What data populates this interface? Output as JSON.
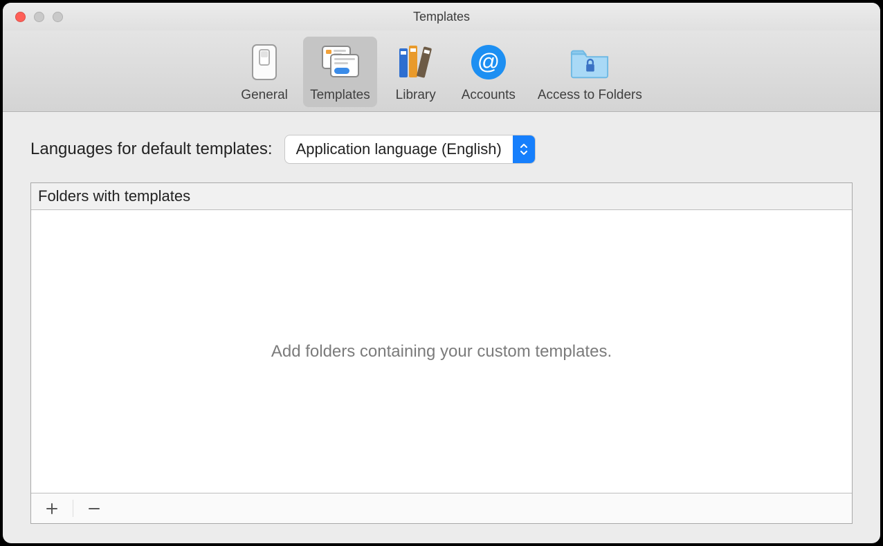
{
  "window": {
    "title": "Templates"
  },
  "toolbar": {
    "items": [
      {
        "id": "general",
        "label": "General"
      },
      {
        "id": "templates",
        "label": "Templates"
      },
      {
        "id": "library",
        "label": "Library"
      },
      {
        "id": "accounts",
        "label": "Accounts"
      },
      {
        "id": "access",
        "label": "Access to Folders"
      }
    ],
    "selected": "templates"
  },
  "languages": {
    "label": "Languages for default templates:",
    "value": "Application language (English)"
  },
  "folders": {
    "header": "Folders with templates",
    "placeholder": "Add folders containing your custom templates.",
    "items": []
  },
  "footer": {
    "add_label": "+",
    "remove_label": "−"
  }
}
